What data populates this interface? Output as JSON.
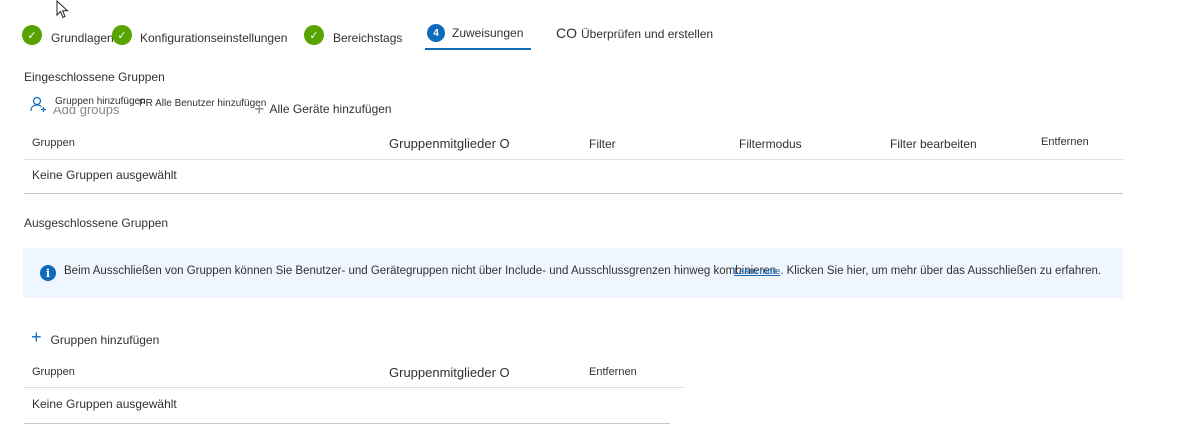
{
  "wizard": {
    "steps": [
      {
        "label": "Grundlagen",
        "state": "done"
      },
      {
        "label": "Konfigurationseinstellungen",
        "state": "done"
      },
      {
        "label": "Bereichstags",
        "state": "done"
      },
      {
        "number": "4",
        "label": "Zuweisungen",
        "state": "current"
      },
      {
        "prefix": "CO",
        "label": "Überprüfen und erstellen",
        "state": "pending"
      }
    ]
  },
  "included": {
    "title": "Eingeschlossene Gruppen",
    "commands": {
      "add_groups": "Gruppen hinzufügen",
      "add_groups_ghost": "Add groups",
      "add_all_users": "PR Alle Benutzer hinzufügen",
      "add_all_devices": "Alle Geräte hinzufügen"
    },
    "columns": [
      "Gruppen",
      "Gruppenmitglieder O",
      "Filter",
      "Filtermodus",
      "Filter bearbeiten",
      "Entfernen"
    ],
    "empty_row": "Keine Gruppen ausgewählt"
  },
  "excluded": {
    "title": "Ausgeschlossene Gruppen",
    "info": {
      "text_before": "Beim Ausschließen von Gruppen können Sie Benutzer- und Gerätegruppen nicht über Include- und Ausschlussgrenzen hinweg kombinieren",
      "link_text": "Learn more",
      "text_after": ". Klicken Sie hier, um mehr über das Ausschließen zu erfahren."
    },
    "add_groups": "Gruppen hinzufügen",
    "columns": [
      "Gruppen",
      "Gruppenmitglieder O",
      "Entfernen"
    ],
    "empty_row": "Keine Gruppen ausgewählt"
  },
  "colors": {
    "done": "#57a300",
    "accent": "#0f6cbd",
    "info_background": "#f0f6ff"
  },
  "icons": {
    "cursor": "mouse-pointer-icon",
    "step_done": "checkmark-circle-icon",
    "add_user": "person-add-icon",
    "add": "plus-icon",
    "info": "info-icon"
  }
}
